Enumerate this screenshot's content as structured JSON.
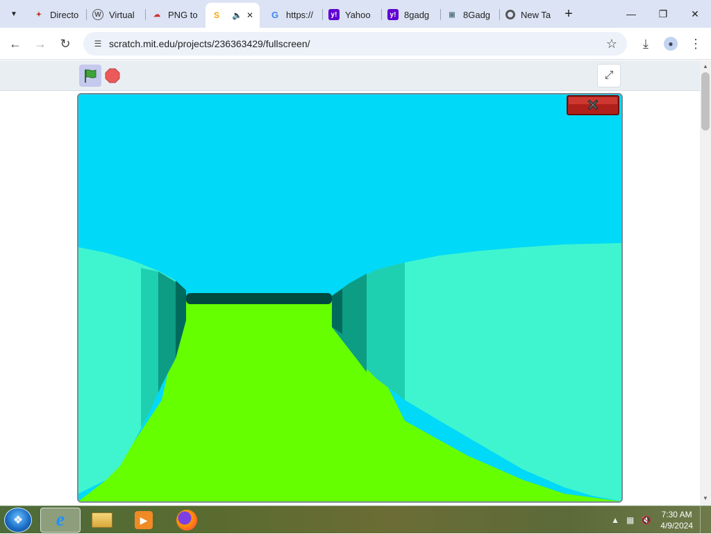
{
  "browser": {
    "tabs": [
      {
        "title": "Directo",
        "favicon": "red-bird-icon",
        "fav_color": "#c0392b"
      },
      {
        "title": "Virtual",
        "favicon": "wikipedia-icon",
        "fav_color": "#555555"
      },
      {
        "title": "PNG to",
        "favicon": "cloud-icon",
        "fav_color": "#cc3333"
      },
      {
        "title": "",
        "favicon": "scratch-icon",
        "fav_color": "#f7a500",
        "active": true
      },
      {
        "title": "https://",
        "favicon": "google-icon",
        "fav_color": "#4285f4"
      },
      {
        "title": "Yahoo",
        "favicon": "yahoo-icon",
        "fav_color": "#6001d2"
      },
      {
        "title": "8gadg",
        "favicon": "yahoo-icon",
        "fav_color": "#6001d2"
      },
      {
        "title": "8Gadg",
        "favicon": "monitor-icon",
        "fav_color": "#607d8b"
      },
      {
        "title": "New Ta",
        "favicon": "chrome-icon",
        "fav_color": "#555555"
      }
    ],
    "url": "scratch.mit.edu/projects/236363429/fullscreen/"
  },
  "scratch": {
    "green_flag_color": "#3fa33a",
    "stop_color": "#ec5959",
    "sky_color": "#00d9f8",
    "floor_color": "#66ff00",
    "wall_light_color": "#3ff5d0",
    "wall_dark_color": "#004a40"
  },
  "taskbar": {
    "time": "7:30 AM",
    "date": "4/9/2024",
    "items": [
      "internet-explorer-icon",
      "file-explorer-icon",
      "media-player-icon",
      "firefox-icon"
    ]
  }
}
